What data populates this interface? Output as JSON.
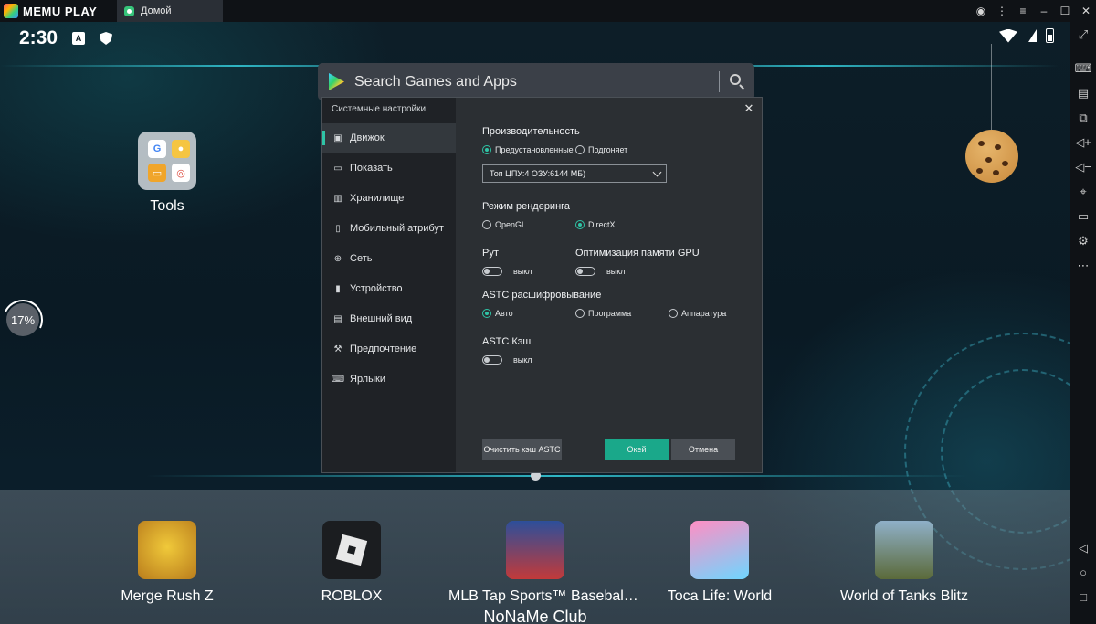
{
  "titlebar": {
    "brand": "MEMU PLAY",
    "tab_label": "Домой"
  },
  "statusbar": {
    "time": "2:30",
    "a_icon": "A"
  },
  "search": {
    "placeholder": "Search Games and Apps"
  },
  "home": {
    "folder_label": "Tools",
    "progress": "17%",
    "progress_value": 0.17,
    "watermark": "NoNaMe Club"
  },
  "dock": [
    {
      "label": "Merge Rush Z",
      "icon": "merge-rush-z-icon"
    },
    {
      "label": "ROBLOX",
      "icon": "roblox-icon"
    },
    {
      "label": "MLB Tap Sports™ Basebal…",
      "icon": "mlb-tap-sports-icon"
    },
    {
      "label": "Toca Life: World",
      "icon": "toca-life-icon"
    },
    {
      "label": "World of Tanks Blitz",
      "icon": "world-of-tanks-icon"
    }
  ],
  "settings": {
    "title": "Системные настройки",
    "nav": [
      {
        "label": "Движок",
        "icon": "engine-icon",
        "active": true
      },
      {
        "label": "Показать",
        "icon": "display-icon"
      },
      {
        "label": "Хранилище",
        "icon": "storage-icon"
      },
      {
        "label": "Мобильный атрибут",
        "icon": "mobile-icon"
      },
      {
        "label": "Сеть",
        "icon": "network-icon"
      },
      {
        "label": "Устройство",
        "icon": "device-icon"
      },
      {
        "label": "Внешний вид",
        "icon": "appearance-icon"
      },
      {
        "label": "Предпочтение",
        "icon": "preference-icon"
      },
      {
        "label": "Ярлыки",
        "icon": "shortcuts-icon"
      }
    ],
    "performance": {
      "label": "Производительность",
      "preset": "Предустановленные",
      "custom": "Подгоняет",
      "selected": "preset",
      "select_value": "Топ ЦПУ:4 ОЗУ:6144 МБ)"
    },
    "render": {
      "label": "Режим рендеринга",
      "opengl": "OpenGL",
      "directx": "DirectX",
      "selected": "directx"
    },
    "root": {
      "label": "Рут",
      "state": "выкл"
    },
    "gpu": {
      "label": "Оптимизация памяти GPU",
      "state": "выкл"
    },
    "astc": {
      "label": "ASTC расшифровывание",
      "auto": "Авто",
      "software": "Программа",
      "hardware": "Аппаратура",
      "selected": "auto"
    },
    "astc_cache": {
      "label": "ASTC Кэш",
      "state": "выкл"
    },
    "buttons": {
      "clear": "Очистить кэш ASTC",
      "ok": "Окей",
      "cancel": "Отмена"
    }
  },
  "colors": {
    "accent": "#2fc4a6",
    "ok_button": "#1aa88a",
    "dialog_bg": "#2b2f33",
    "sidebar_bg": "#1f2226"
  }
}
